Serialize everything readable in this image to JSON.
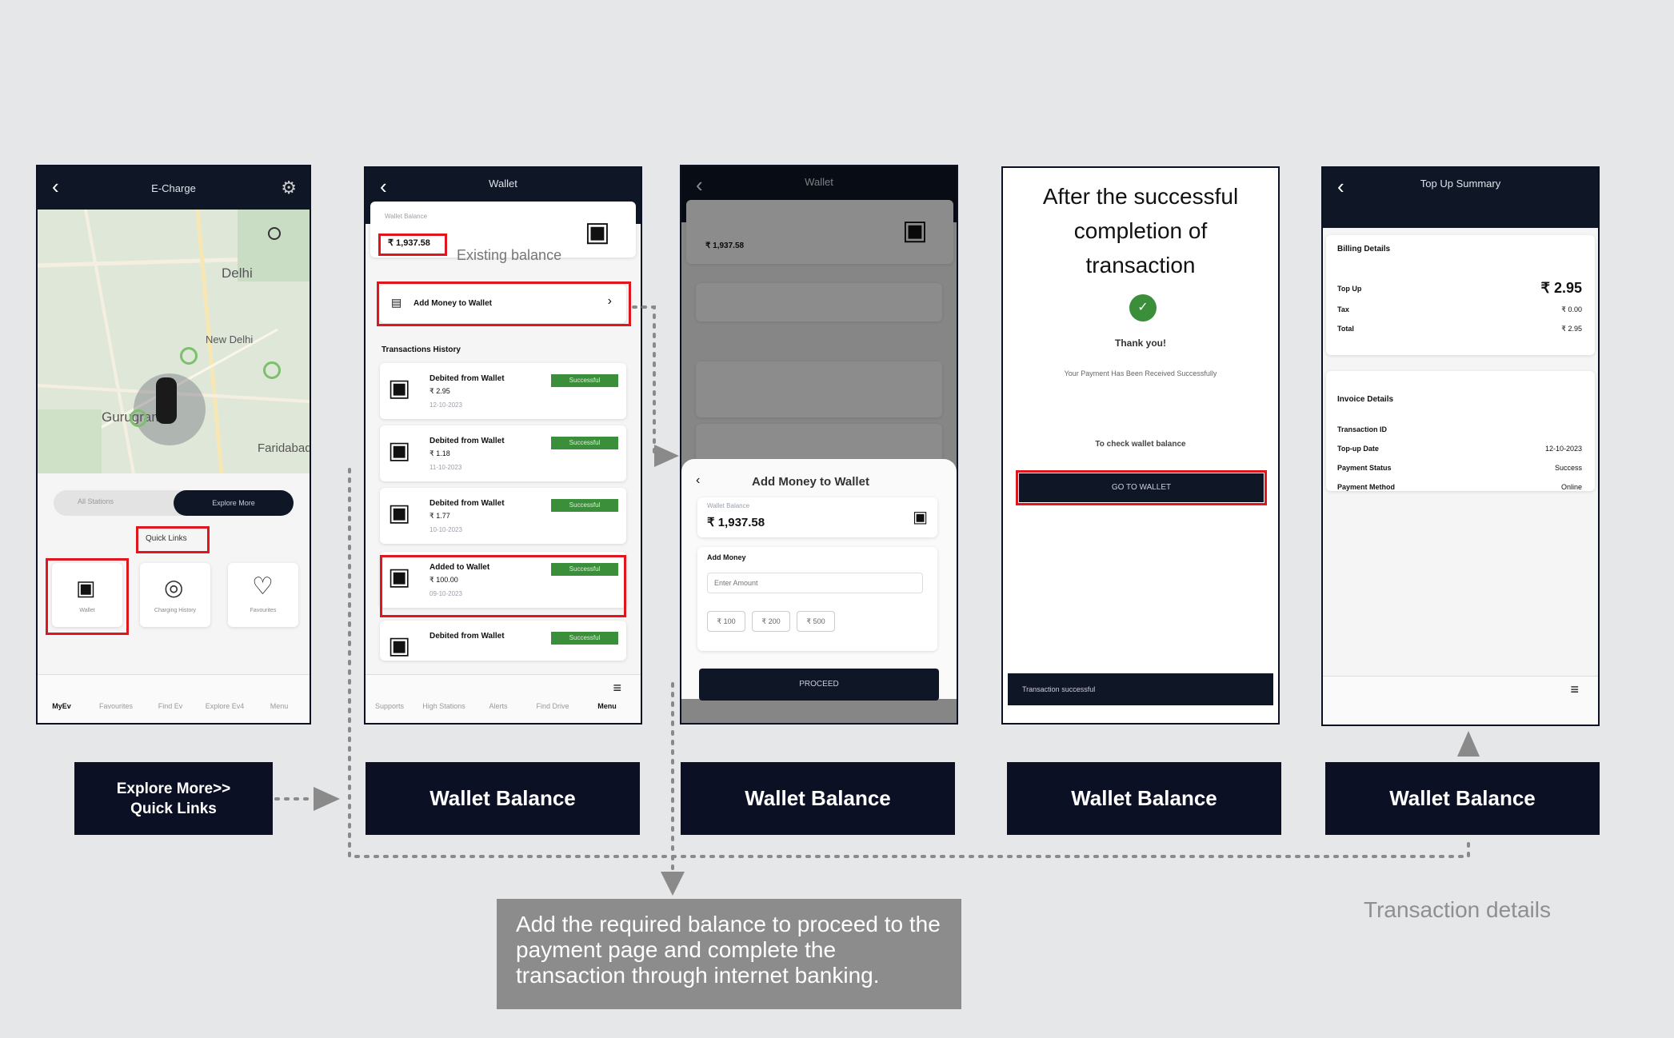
{
  "screen1": {
    "title": "E-Charge",
    "map_labels": [
      "Delhi",
      "New Delhi",
      "Gurugram",
      "Faridabad"
    ],
    "tabs": [
      "All Stations",
      "Explore More"
    ],
    "quick_links_label": "Quick Links",
    "quick_links": [
      "Wallet",
      "Charging History",
      "Favourites"
    ],
    "bottom_nav": [
      "MyEv",
      "Favourites",
      "Find Ev",
      "Explore Ev4",
      "Menu"
    ]
  },
  "screen2": {
    "title": "Wallet",
    "wallet_label": "Wallet Balance",
    "balance": "₹ 1,937.58",
    "existing_balance_note": "Existing balance",
    "add_money": "Add Money to Wallet",
    "history_label": "Transactions History",
    "transactions": [
      {
        "title": "Debited from Wallet",
        "amount": "₹ 2.95",
        "date": "12-10-2023",
        "status": "Successful"
      },
      {
        "title": "Debited from Wallet",
        "amount": "₹ 1.18",
        "date": "11-10-2023",
        "status": "Successful"
      },
      {
        "title": "Debited from Wallet",
        "amount": "₹ 1.77",
        "date": "10-10-2023",
        "status": "Successful"
      },
      {
        "title": "Added to Wallet",
        "amount": "₹ 100.00",
        "date": "09-10-2023",
        "status": "Successful"
      },
      {
        "title": "Debited from Wallet",
        "amount": "",
        "date": "",
        "status": "Successful"
      }
    ],
    "bottom_nav": [
      "Supports",
      "High Stations",
      "Alerts",
      "Find Drive",
      "Menu"
    ]
  },
  "screen3": {
    "title": "Wallet",
    "sheet_title": "Add Money to Wallet",
    "wallet_label": "Wallet Balance",
    "balance": "₹ 1,937.58",
    "add_money_label": "Add Money",
    "amount_placeholder": "Enter Amount",
    "chips": [
      "₹ 100",
      "₹ 200",
      "₹ 500"
    ],
    "proceed": "PROCEED"
  },
  "screen4": {
    "heading": "After the successful completion of transaction",
    "thank_you": "Thank you!",
    "message": "Your Payment Has Been Received Successfully",
    "check_text": "To check wallet balance",
    "button": "GO TO WALLET",
    "toast": "Transaction successful"
  },
  "screen5": {
    "title": "Top Up Summary",
    "billing_label": "Billing Details",
    "billing": [
      {
        "label": "Top Up",
        "value": "₹ 2.95"
      },
      {
        "label": "Tax",
        "value": "₹ 0.00"
      },
      {
        "label": "Total",
        "value": "₹ 2.95"
      }
    ],
    "invoice_label": "Invoice Details",
    "invoice": [
      {
        "label": "Transaction ID",
        "value": ""
      },
      {
        "label": "Top-up Date",
        "value": "12-10-2023"
      },
      {
        "label": "Payment Status",
        "value": "Success"
      },
      {
        "label": "Payment Method",
        "value": "Online"
      }
    ]
  },
  "labels": {
    "explore": "Explore More>>\nQuick Links",
    "wallet_balance_1": "Wallet Balance",
    "wallet_balance_2": "Wallet Balance",
    "wallet_balance_3": "Wallet Balance",
    "wallet_balance_4": "Wallet Balance",
    "add_note": "Add the required balance to proceed to the payment page and complete the transaction through internet banking.",
    "transaction_details": "Transaction details"
  },
  "colors": {
    "background": "#e6e7e9",
    "navy": "#0b1024",
    "highlight": "#e0161f",
    "success": "#3c8f3a"
  }
}
